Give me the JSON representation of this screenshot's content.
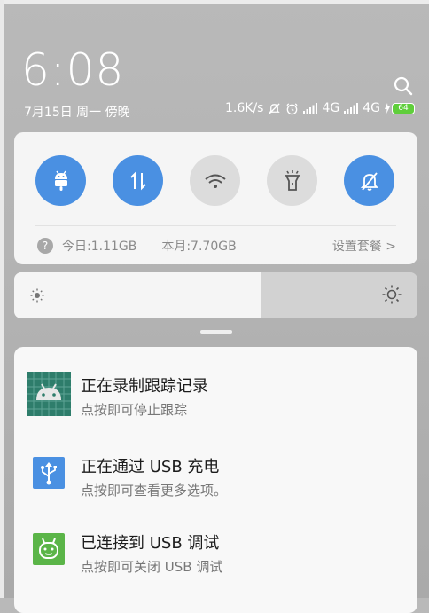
{
  "lockscreen": {
    "time": "6:08",
    "date": "7月15日 周一 傍晚"
  },
  "status_bar": {
    "net_speed": "1.6K/s",
    "network1": "4G",
    "network2": "4G",
    "battery": "64",
    "battery_color": "#5fce3b"
  },
  "quick_settings": {
    "toggles": [
      {
        "name": "android-debug",
        "state": "on",
        "icon": "android-icon"
      },
      {
        "name": "mobile-data",
        "state": "on",
        "icon": "data-transfer-icon"
      },
      {
        "name": "wifi",
        "state": "off",
        "icon": "wifi-icon"
      },
      {
        "name": "flashlight",
        "state": "off",
        "icon": "flashlight-icon"
      },
      {
        "name": "mute-notifications",
        "state": "on",
        "icon": "bell-off-icon"
      }
    ],
    "info_symbol": "?",
    "today_usage": "今日:1.11GB",
    "month_usage": "本月:7.70GB",
    "plan_link": "设置套餐 >",
    "accent": "#4a90e2"
  },
  "brightness": {
    "level": 0.61
  },
  "notifications": [
    {
      "title": "正在录制跟踪记录",
      "text": "点按即可停止跟踪",
      "icon": "android-trace-icon"
    },
    {
      "title": "正在通过 USB 充电",
      "text": "点按即可查看更多选项。",
      "icon": "usb-icon"
    },
    {
      "title": "已连接到 USB 调试",
      "text": "点按即可关闭 USB 调试",
      "icon": "android-debug-icon"
    }
  ]
}
